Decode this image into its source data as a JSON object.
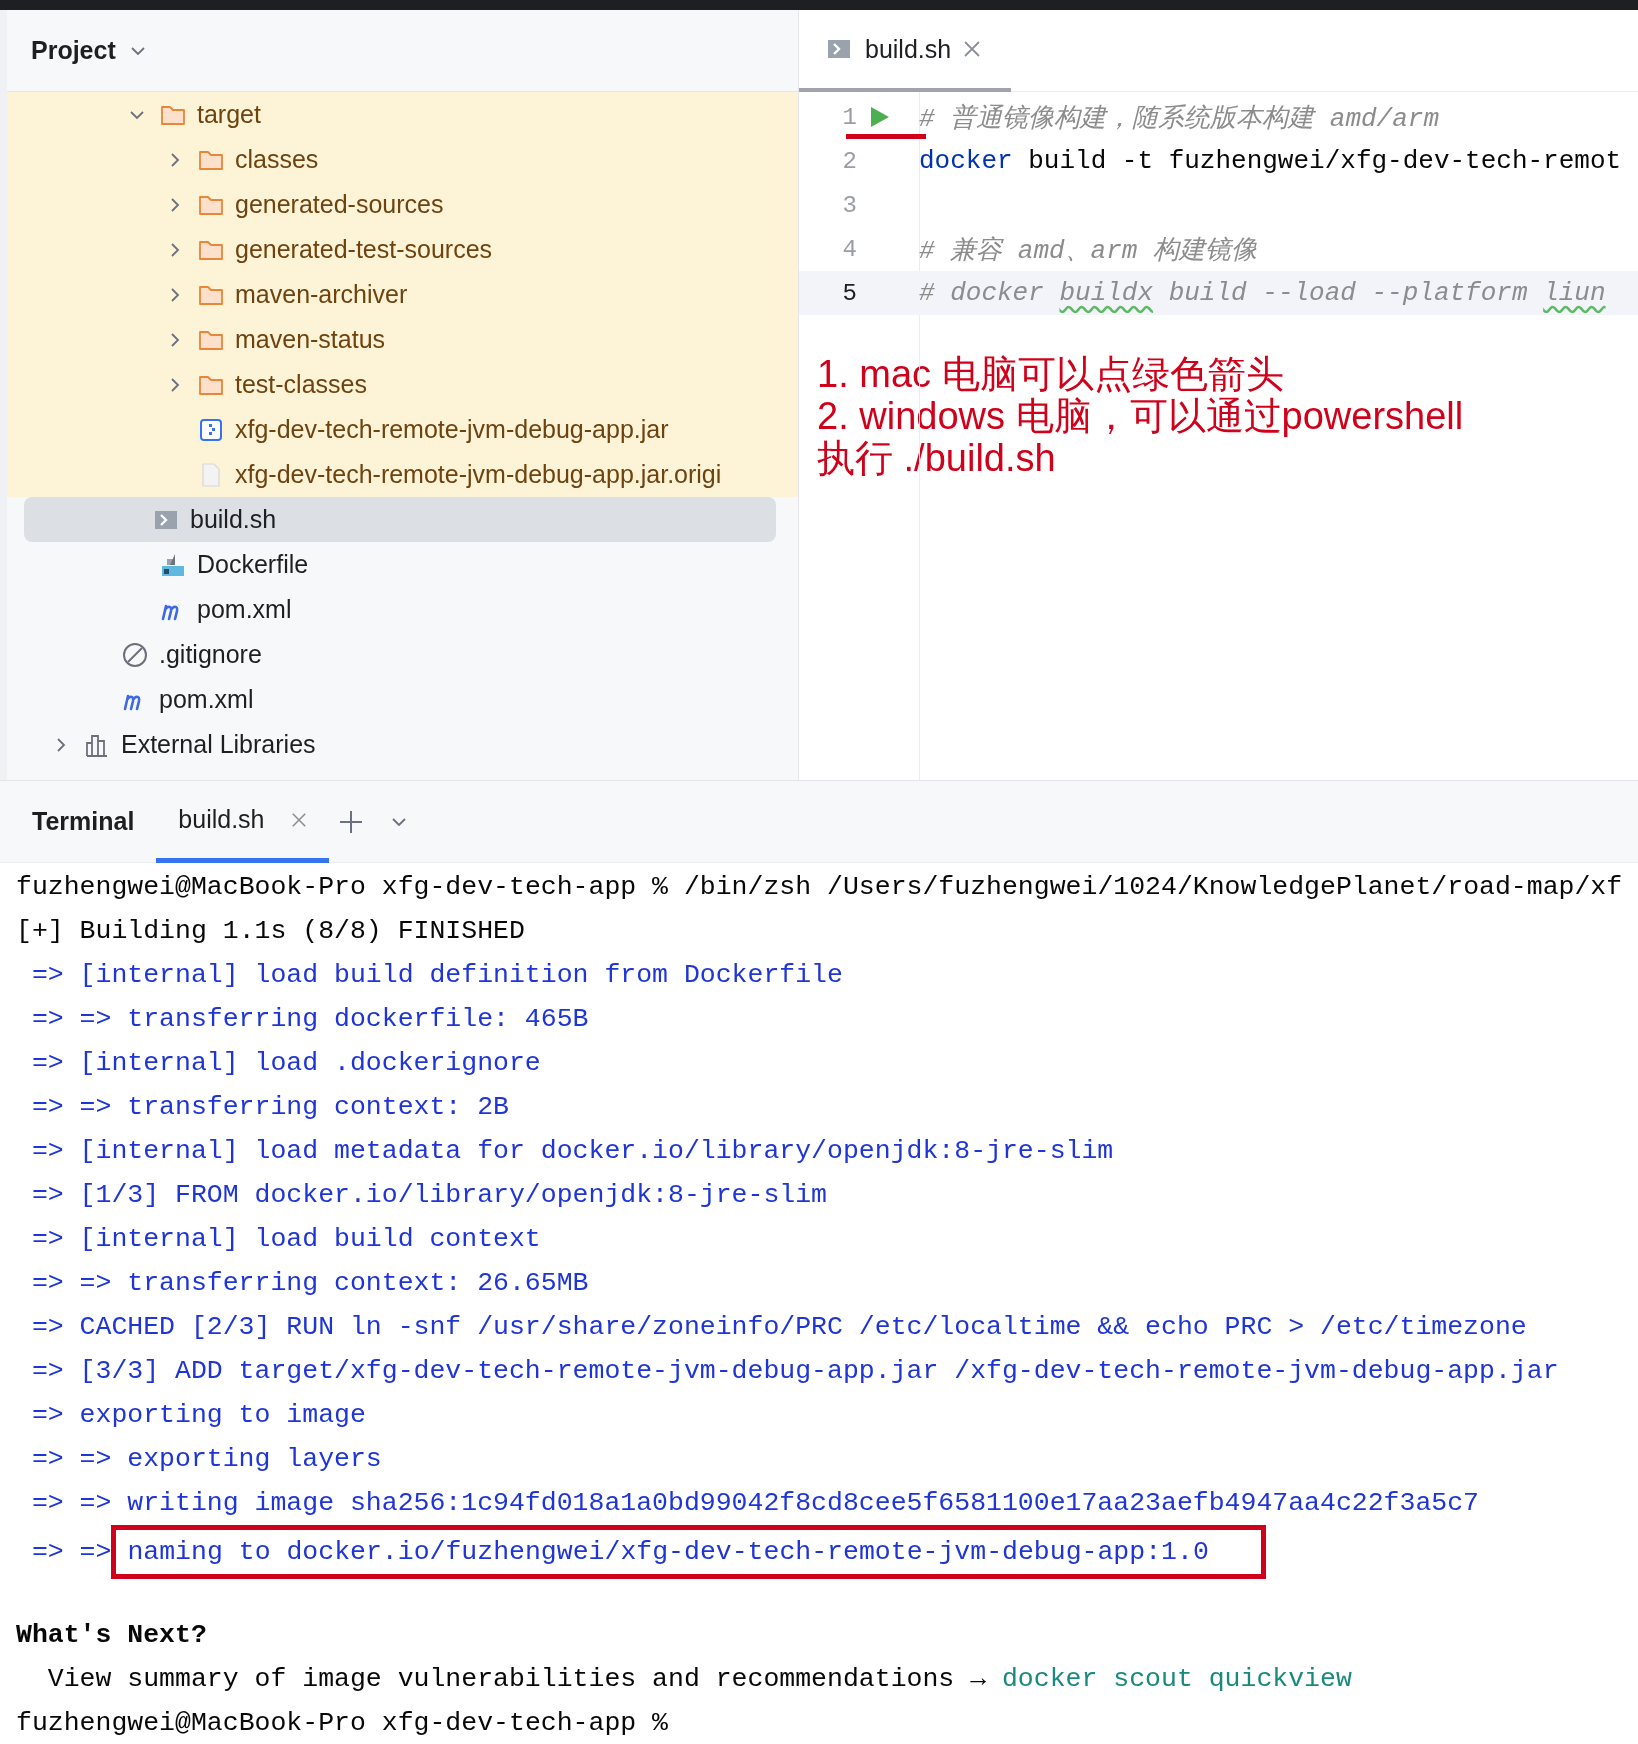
{
  "project_panel": {
    "title": "Project",
    "tree": [
      {
        "children": [
          {
            "children": [
              {
                "label": "target",
                "kind": "folder",
                "expanded": true,
                "excluded": true,
                "selected": false,
                "children": [
                  {
                    "label": "classes",
                    "kind": "folder",
                    "expanded": false,
                    "excluded": true,
                    "selected": false
                  },
                  {
                    "label": "generated-sources",
                    "kind": "folder",
                    "expanded": false,
                    "excluded": true,
                    "selected": false
                  },
                  {
                    "label": "generated-test-sources",
                    "kind": "folder",
                    "expanded": false,
                    "excluded": true,
                    "selected": false
                  },
                  {
                    "label": "maven-archiver",
                    "kind": "folder",
                    "expanded": false,
                    "excluded": true,
                    "selected": false
                  },
                  {
                    "label": "maven-status",
                    "kind": "folder",
                    "expanded": false,
                    "excluded": true,
                    "selected": false
                  },
                  {
                    "label": "test-classes",
                    "kind": "folder",
                    "expanded": false,
                    "excluded": true,
                    "selected": false
                  },
                  {
                    "label": "xfg-dev-tech-remote-jvm-debug-app.jar",
                    "kind": "jar",
                    "excluded": true,
                    "selected": false
                  },
                  {
                    "label": "xfg-dev-tech-remote-jvm-debug-app.jar.origi",
                    "kind": "file",
                    "excluded": true,
                    "selected": false
                  }
                ]
              },
              {
                "label": "build.sh",
                "kind": "shell",
                "excluded": false,
                "selected": true
              },
              {
                "label": "Dockerfile",
                "kind": "docker",
                "excluded": false,
                "selected": false
              },
              {
                "label": "pom.xml",
                "kind": "maven",
                "excluded": false,
                "selected": false
              }
            ]
          },
          {
            "label": ".gitignore",
            "kind": "ignore",
            "excluded": false,
            "selected": false
          },
          {
            "label": "pom.xml",
            "kind": "maven",
            "excluded": false,
            "selected": false
          }
        ]
      },
      {
        "label": "External Libraries",
        "kind": "library",
        "expanded": false,
        "excluded": false,
        "selected": false
      }
    ]
  },
  "editor": {
    "tabs": [
      {
        "label": "build.sh",
        "selected": true
      }
    ],
    "lines": [
      {
        "number": "1",
        "run": true,
        "current": false,
        "segments": [
          {
            "kind": "comment",
            "text": "# 普通镜像构建，随系统版本构建 amd/arm"
          }
        ]
      },
      {
        "number": "2",
        "current": false,
        "segments": [
          {
            "kind": "keyword",
            "text": "docker"
          },
          {
            "kind": "plain",
            "text": " build -t fuzhengwei/xfg-dev-tech-remot"
          }
        ]
      },
      {
        "number": "3",
        "current": false
      },
      {
        "number": "4",
        "current": false,
        "segments": [
          {
            "kind": "comment",
            "text": "# 兼容 amd、arm 构建镜像"
          }
        ]
      },
      {
        "number": "5",
        "current": true,
        "segments": [
          {
            "kind": "comment",
            "text": "# docker "
          },
          {
            "kind": "typo",
            "text": "buildx"
          },
          {
            "kind": "comment",
            "text": " build --load --platform "
          },
          {
            "kind": "typo",
            "text": "liun"
          }
        ]
      }
    ],
    "note": [
      "1. mac 电脑可以点绿色箭头",
      "2. windows 电脑，可以通过powershell",
      "执行 ./build.sh"
    ]
  },
  "terminal": {
    "title": "Terminal",
    "tabs": [
      {
        "label": "build.sh",
        "selected": true
      }
    ],
    "lines": [
      {
        "kind": "prompt",
        "text": "fuzhengwei@MacBook-Pro xfg-dev-tech-app % /bin/zsh /Users/fuzhengwei/1024/KnowledgePlanet/road-map/xf"
      },
      {
        "kind": "plain",
        "text": "[+] Building 1.1s (8/8) FINISHED"
      },
      {
        "kind": "info",
        "text": "=> [internal] load build definition from Dockerfile"
      },
      {
        "kind": "info",
        "text": "=> => transferring dockerfile: 465B"
      },
      {
        "kind": "info",
        "text": "=> [internal] load .dockerignore"
      },
      {
        "kind": "info",
        "text": "=> => transferring context: 2B"
      },
      {
        "kind": "info",
        "text": "=> [internal] load metadata for docker.io/library/openjdk:8-jre-slim"
      },
      {
        "kind": "info",
        "text": "=> [1/3] FROM docker.io/library/openjdk:8-jre-slim"
      },
      {
        "kind": "info",
        "text": "=> [internal] load build context"
      },
      {
        "kind": "info",
        "text": "=> => transferring context: 26.65MB"
      },
      {
        "kind": "info",
        "text": "=> CACHED [2/3] RUN ln -snf /usr/share/zoneinfo/PRC /etc/localtime && echo PRC > /etc/timezone"
      },
      {
        "kind": "info",
        "text": "=> [3/3] ADD target/xfg-dev-tech-remote-jvm-debug-app.jar /xfg-dev-tech-remote-jvm-debug-app.jar"
      },
      {
        "kind": "info",
        "text": "=> exporting to image"
      },
      {
        "kind": "info",
        "text": "=> => exporting layers"
      },
      {
        "kind": "info",
        "text": "=> => writing image sha256:1c94fd018a1a0bd99042f8cd8cee5f6581100e17aa23aefb4947aa4c22f3a5c7"
      },
      {
        "kind": "boxed",
        "prefix": "=> =>",
        "text": "naming to docker.io/fuzhengwei/xfg-dev-tech-remote-jvm-debug-app:1.0"
      },
      {
        "kind": "heading",
        "text": "What's Next?"
      },
      {
        "kind": "hint",
        "text": "View summary of image vulnerabilities and recommendations →",
        "link": "docker scout quickview"
      },
      {
        "kind": "prompt",
        "text": "fuzhengwei@MacBook-Pro xfg-dev-tech-app %"
      }
    ]
  }
}
